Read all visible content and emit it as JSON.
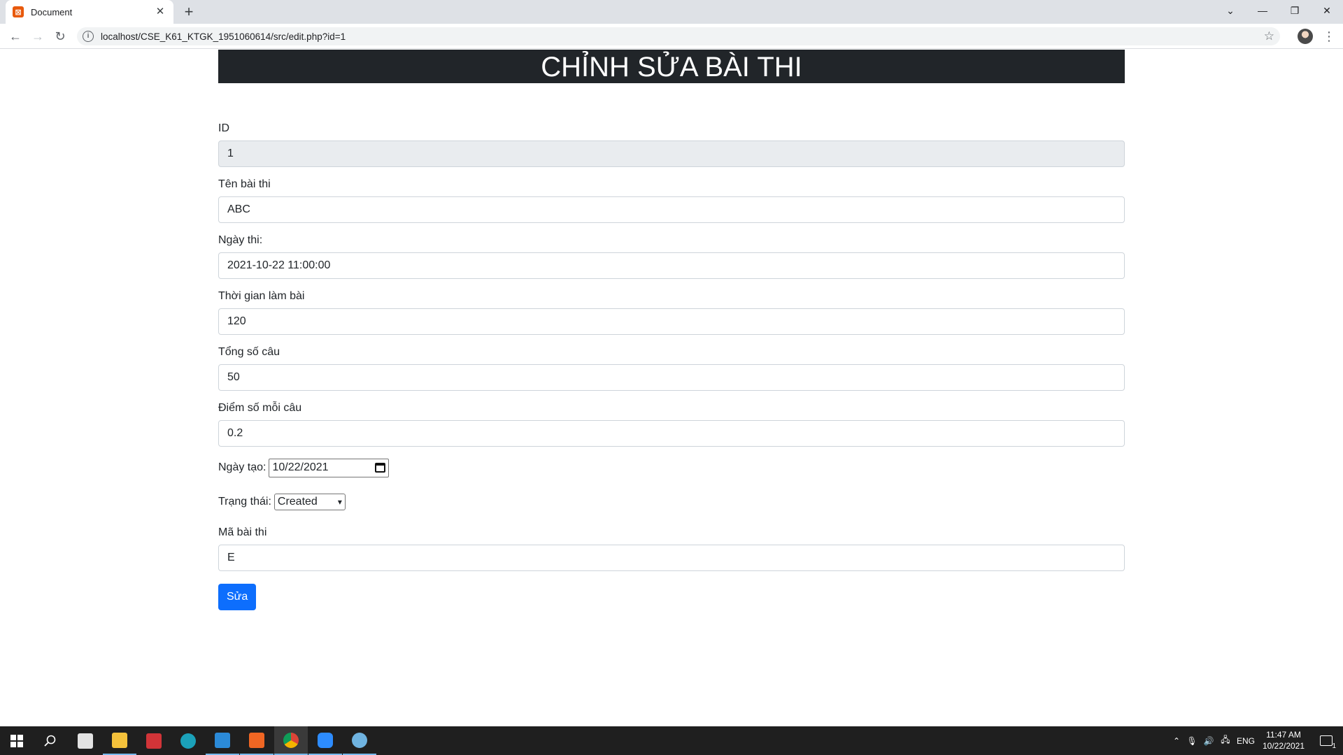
{
  "browser": {
    "tab_title": "Document",
    "url": "localhost/CSE_K61_KTGK_1951060614/src/edit.php?id=1",
    "favicon_letter": "⊠"
  },
  "page": {
    "heading": "CHỈNH SỬA BÀI THI",
    "fields": {
      "id": {
        "label": "ID",
        "value": "1"
      },
      "name": {
        "label": "Tên bài thi",
        "value": "ABC"
      },
      "exam_date": {
        "label": "Ngày thi:",
        "value": "2021-10-22 11:00:00"
      },
      "duration": {
        "label": "Thời gian làm bài",
        "value": "120"
      },
      "total_questions": {
        "label": "Tổng số câu",
        "value": "50"
      },
      "score_per_question": {
        "label": "Điểm số mỗi câu",
        "value": "0.2"
      },
      "created_date": {
        "label": "Ngày tạo:",
        "value": "10/22/2021"
      },
      "status": {
        "label": "Trạng thái:",
        "value": "Created"
      },
      "code": {
        "label": "Mã bài thi",
        "value": "E"
      }
    },
    "submit_label": "Sửa"
  },
  "taskbar": {
    "language": "ENG",
    "time": "11:47 AM",
    "date": "10/22/2021",
    "notification_count": "1"
  },
  "colors": {
    "header_bg": "#212529",
    "primary": "#0d6efd",
    "readonly_bg": "#e9ecef"
  }
}
